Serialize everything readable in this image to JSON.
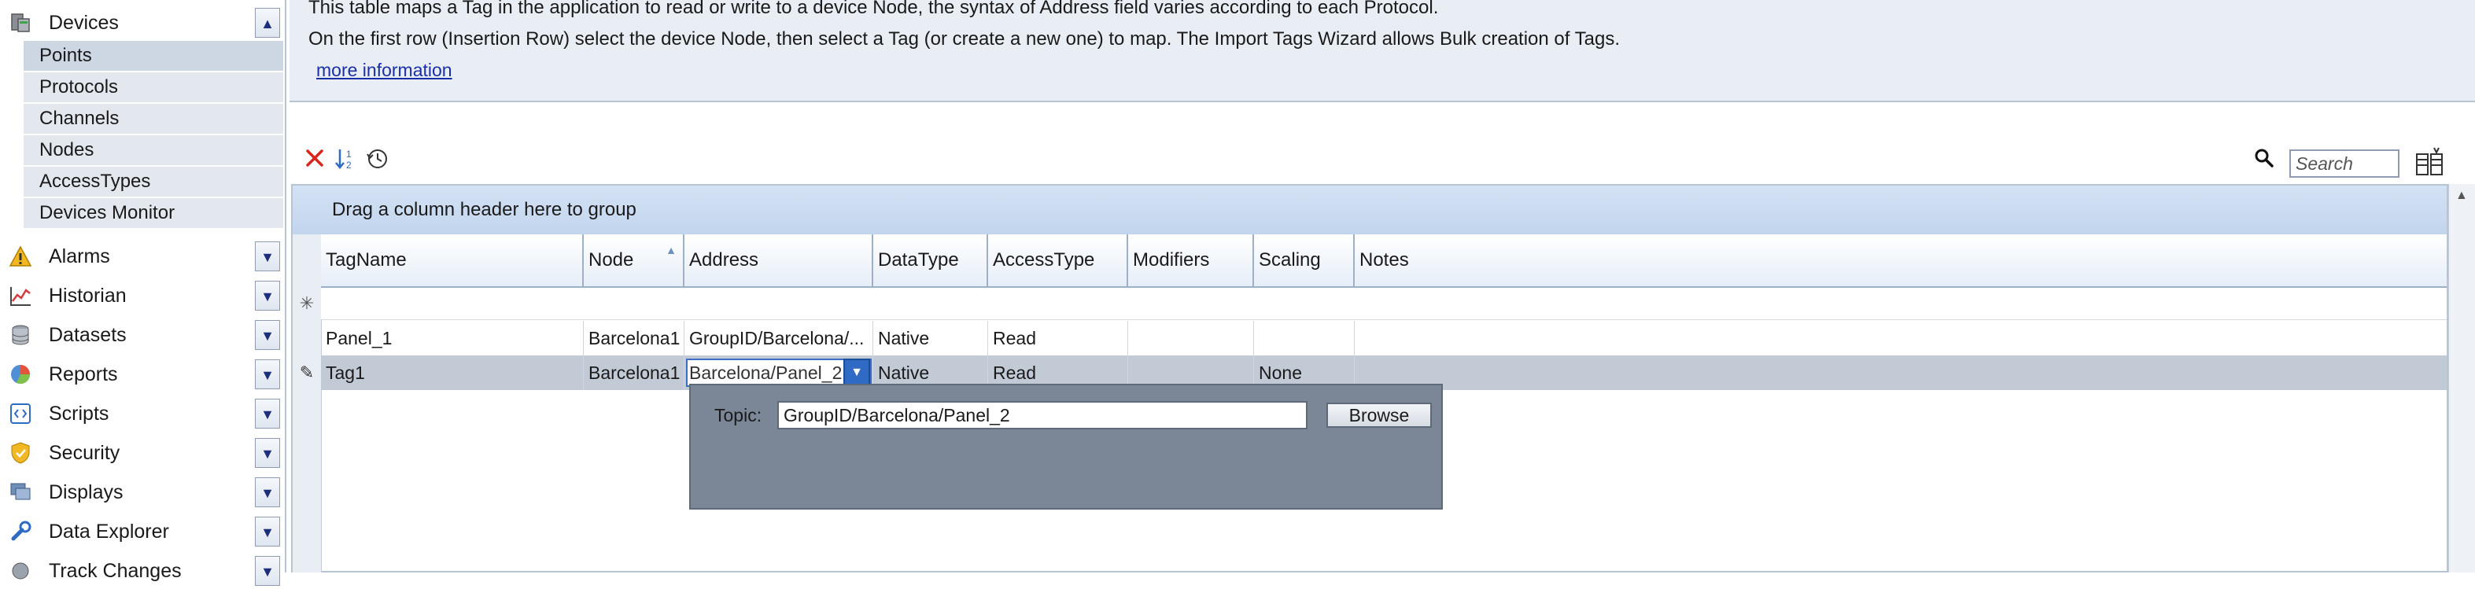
{
  "sidebar": {
    "devices": {
      "label": "Devices",
      "icon": "devices-icon"
    },
    "device_items": [
      {
        "label": "Points"
      },
      {
        "label": "Protocols"
      },
      {
        "label": "Channels"
      },
      {
        "label": "Nodes"
      },
      {
        "label": "AccessTypes"
      },
      {
        "label": "Devices Monitor"
      }
    ],
    "categories": [
      {
        "label": "Alarms",
        "icon": "alarm-icon"
      },
      {
        "label": "Historian",
        "icon": "historian-icon"
      },
      {
        "label": "Datasets",
        "icon": "datasets-icon"
      },
      {
        "label": "Reports",
        "icon": "reports-icon"
      },
      {
        "label": "Scripts",
        "icon": "scripts-icon"
      },
      {
        "label": "Security",
        "icon": "security-icon"
      },
      {
        "label": "Displays",
        "icon": "displays-icon"
      },
      {
        "label": "Data Explorer",
        "icon": "data-explorer-icon"
      },
      {
        "label": "Track Changes",
        "icon": "track-changes-icon"
      }
    ]
  },
  "info": {
    "line1": "This table maps a Tag in the application to read or write to a device Node, the syntax of Address field varies according to each Protocol.",
    "line2": "On the first row (Insertion Row) select the device Node, then select a Tag (or create a new one) to map. The Import Tags Wizard allows Bulk creation of Tags.",
    "link": "more information"
  },
  "toolbar": {
    "search_placeholder": "Search",
    "icons": [
      "delete-icon",
      "sort-icon",
      "history-icon",
      "search-icon",
      "column-chooser-icon"
    ]
  },
  "grid": {
    "group_hint": "Drag a column header here to group",
    "columns": [
      "TagName",
      "Node",
      "Address",
      "DataType",
      "AccessType",
      "Modifiers",
      "Scaling",
      "Notes"
    ],
    "sorted_column": "Node",
    "rows": [
      {
        "TagName": "Panel_1",
        "Node": "Barcelona1",
        "Address": "GroupID/Barcelona/...",
        "DataType": "Native",
        "AccessType": "Read",
        "Modifiers": "",
        "Scaling": "",
        "Notes": ""
      },
      {
        "TagName": "Tag1",
        "Node": "Barcelona1",
        "Address": "Barcelona/Panel_2",
        "DataType": "Native",
        "AccessType": "Read",
        "Modifiers": "",
        "Scaling": "None",
        "Notes": ""
      }
    ],
    "insert_marker": "✳",
    "edit_marker": "✎"
  },
  "address_popup": {
    "label": "Topic:",
    "value": "GroupID/Barcelona/Panel_2",
    "browse_label": "Browse"
  },
  "colors": {
    "info_bg": "#e9eef5",
    "group_bar": "#c2d5ee",
    "selected_row": "#c2cad6",
    "popup_bg": "#7b8796",
    "delete_red": "#d9261c",
    "accent_blue": "#2f6bc4"
  }
}
